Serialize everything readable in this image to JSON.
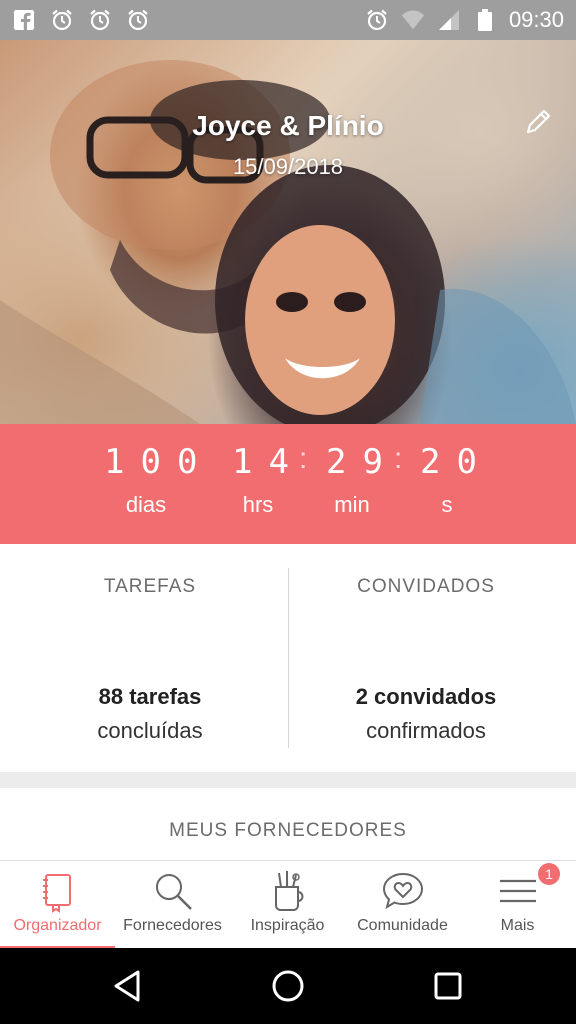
{
  "status_bar": {
    "time": "09:30",
    "left_icons": [
      "facebook-icon",
      "alarm-icon",
      "alarm-icon",
      "alarm-icon"
    ],
    "right_icons": [
      "alarm-icon",
      "wifi-icon",
      "signal-icon",
      "battery-icon"
    ]
  },
  "hero": {
    "title": "Joyce & Plínio",
    "date": "15/09/2018",
    "edit_icon": "pencil-icon"
  },
  "countdown": {
    "days": "100",
    "hours": "14",
    "minutes": "29",
    "seconds": "20",
    "days_label": "dias",
    "hours_label": "hrs",
    "minutes_label": "min",
    "seconds_label": "s",
    "color": "#f26d6f"
  },
  "cards": {
    "tasks": {
      "title": "TAREFAS",
      "value": "88 tarefas",
      "sub": "concluídas"
    },
    "guests": {
      "title": "CONVIDADOS",
      "value": "2 convidados",
      "sub": "confirmados"
    }
  },
  "suppliers": {
    "title": "MEUS FORNECEDORES"
  },
  "tabbar": {
    "items": [
      {
        "label": "Organizador",
        "icon": "notebook-icon",
        "active": true
      },
      {
        "label": "Fornecedores",
        "icon": "search-icon",
        "active": false
      },
      {
        "label": "Inspiração",
        "icon": "pencil-cup-icon",
        "active": false
      },
      {
        "label": "Comunidade",
        "icon": "heart-chat-icon",
        "active": false
      },
      {
        "label": "Mais",
        "icon": "menu-icon",
        "active": false
      }
    ],
    "badge": "1",
    "accent": "#f26d6f"
  }
}
